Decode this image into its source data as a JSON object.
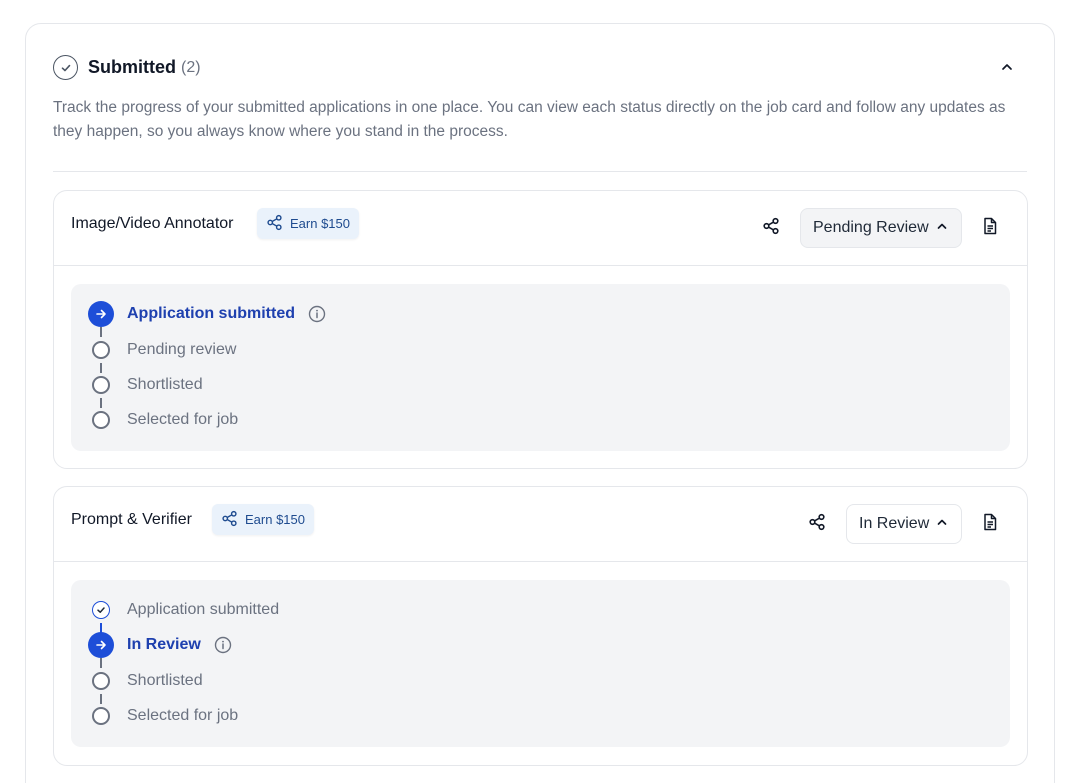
{
  "section": {
    "title": "Submitted",
    "count": "(2)",
    "description": "Track the progress of your submitted applications in one place. You can view each status directly on the job card and follow any updates as they happen, so you always know where you stand in the process.",
    "header_icon": "check-circle-icon",
    "collapse_icon": "chevron-up-icon"
  },
  "colors": {
    "accent": "#1d4ed8",
    "badge_bg": "#eaf2fb",
    "badge_text": "#1e4b8f",
    "muted_text": "#6b7280",
    "timeline_bg": "#f3f4f6"
  },
  "jobs": [
    {
      "title": "Image/Video Annotator",
      "earn_label": "Earn $150",
      "status_label": "Pending Review",
      "steps": [
        {
          "label": "Application submitted",
          "state": "active"
        },
        {
          "label": "Pending review",
          "state": "pending"
        },
        {
          "label": "Shortlisted",
          "state": "pending"
        },
        {
          "label": "Selected for job",
          "state": "pending"
        }
      ]
    },
    {
      "title": "Prompt & Verifier",
      "earn_label": "Earn $150",
      "status_label": "In Review",
      "steps": [
        {
          "label": "Application submitted",
          "state": "done"
        },
        {
          "label": "In Review",
          "state": "active"
        },
        {
          "label": "Shortlisted",
          "state": "pending"
        },
        {
          "label": "Selected for job",
          "state": "pending"
        }
      ]
    }
  ]
}
